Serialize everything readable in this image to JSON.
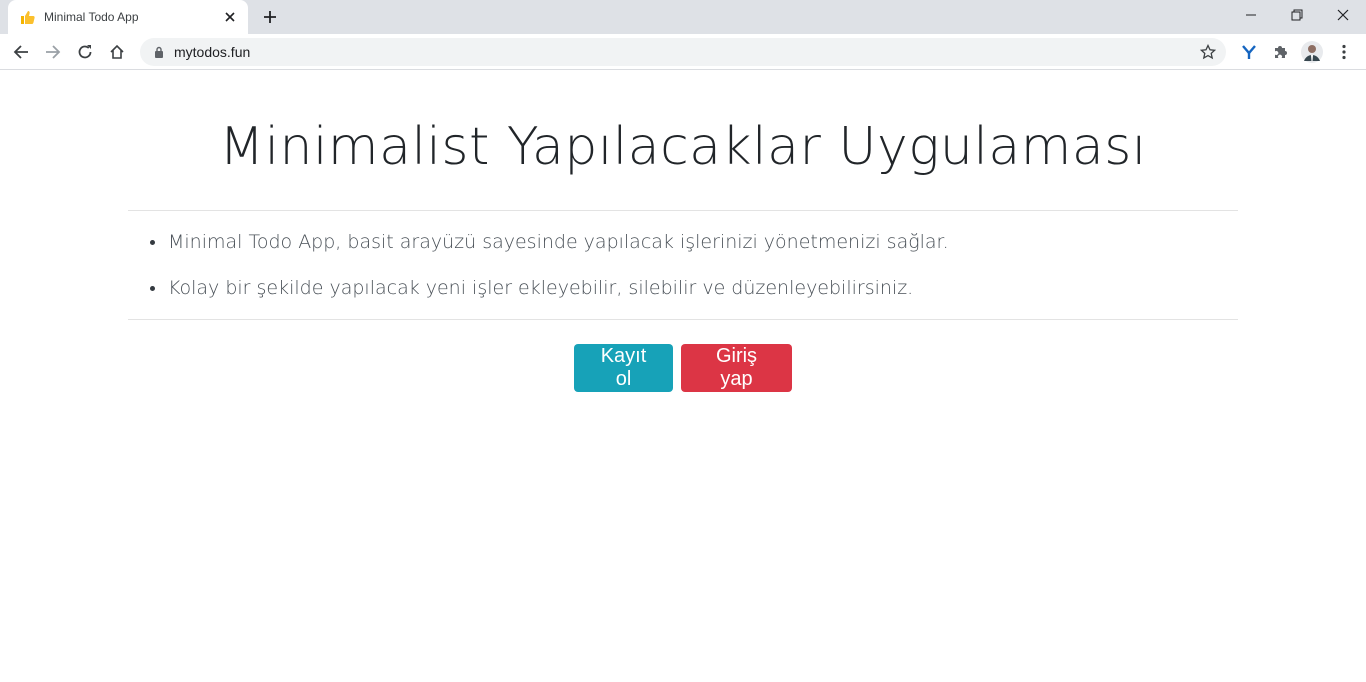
{
  "browser": {
    "tab_title": "Minimal Todo App",
    "url": "mytodos.fun",
    "favicon": "thumbs-up-icon",
    "colors": {
      "tabstrip": "#dee1e6",
      "omnibox": "#f1f3f4"
    }
  },
  "page": {
    "title": "Minimalist Yapılacaklar Uygulaması",
    "features": [
      "Minimal Todo App, basit arayüzü sayesinde yapılacak işlerinizi yönetmenizi sağlar.",
      "Kolay bir şekilde yapılacak yeni işler ekleyebilir, silebilir ve düzenleyebilirsiniz."
    ],
    "register_label": "Kayıt ol",
    "login_label": "Giriş yap",
    "colors": {
      "register": "#17a2b8",
      "login": "#dc3545"
    }
  }
}
